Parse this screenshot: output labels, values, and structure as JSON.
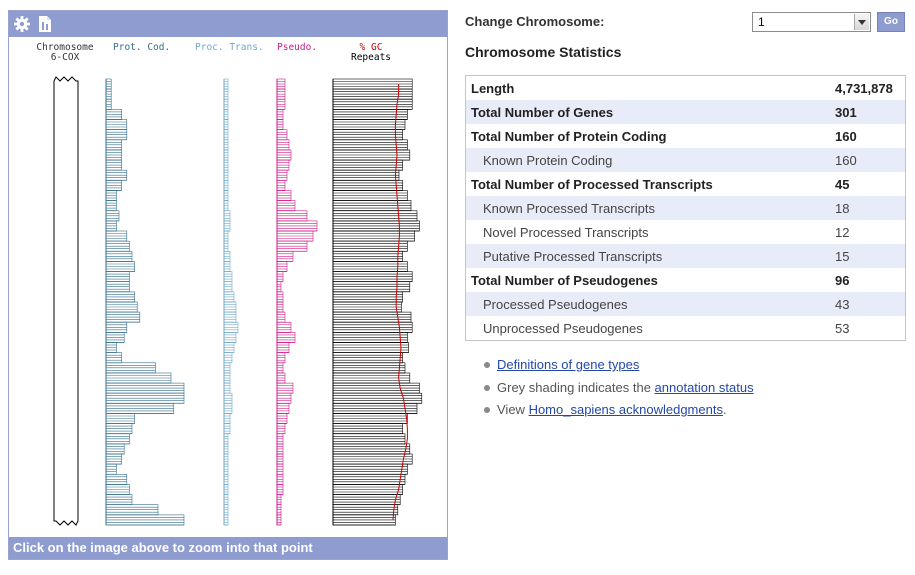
{
  "panel": {
    "footer_text": "Click on the image above to zoom into that point",
    "icons": [
      "gear-icon",
      "karyotype-icon"
    ],
    "tracks": {
      "chromosome_label": "Chromosome",
      "chromosome_name": "6-COX",
      "prot_cod_label": "Prot. Cod.",
      "proc_trans_label": "Proc. Trans.",
      "pseudo_label": "Pseudo.",
      "gc_label": "% GC",
      "repeats_label": "Repeats"
    },
    "colors": {
      "prot_cod": "#336e8c",
      "proc_trans": "#6fa8c8",
      "pseudo": "#cc1a8a",
      "gc": "#cc0000",
      "repeats": "#000000",
      "header": "#8f9cd0"
    }
  },
  "density": {
    "bins": 44,
    "prot_cod": [
      2,
      2,
      2,
      6,
      8,
      8,
      6,
      6,
      6,
      8,
      6,
      4,
      4,
      5,
      4,
      8,
      9,
      10,
      11,
      9,
      9,
      11,
      12,
      13,
      8,
      7,
      4,
      6,
      19,
      25,
      30,
      30,
      26,
      11,
      10,
      9,
      7,
      6,
      4,
      8,
      9,
      10,
      20,
      30
    ],
    "proc_trans": [
      2,
      2,
      2,
      2,
      2,
      2,
      2,
      2,
      2,
      2,
      2,
      2,
      2,
      3,
      3,
      2,
      2,
      3,
      3,
      4,
      4,
      5,
      6,
      6,
      7,
      6,
      5,
      4,
      3,
      3,
      3,
      4,
      4,
      3,
      3,
      2,
      2,
      2,
      2,
      2,
      2,
      2,
      2,
      2
    ],
    "pseudo": [
      4,
      4,
      4,
      3,
      3,
      5,
      6,
      7,
      6,
      5,
      4,
      7,
      9,
      15,
      20,
      18,
      15,
      8,
      5,
      3,
      2,
      3,
      3,
      4,
      7,
      9,
      6,
      4,
      3,
      4,
      8,
      7,
      6,
      5,
      4,
      3,
      3,
      3,
      3,
      3,
      3,
      2,
      2,
      2
    ],
    "repeats": [
      66,
      66,
      66,
      62,
      60,
      58,
      62,
      64,
      58,
      55,
      58,
      62,
      65,
      70,
      72,
      68,
      62,
      58,
      62,
      66,
      64,
      58,
      57,
      65,
      66,
      62,
      63,
      58,
      60,
      64,
      72,
      74,
      70,
      62,
      58,
      60,
      64,
      66,
      62,
      60,
      58,
      56,
      54,
      52
    ],
    "gc": [
      0.82,
      0.82,
      0.8,
      0.79,
      0.78,
      0.78,
      0.79,
      0.8,
      0.79,
      0.78,
      0.79,
      0.8,
      0.81,
      0.82,
      0.83,
      0.83,
      0.82,
      0.81,
      0.81,
      0.8,
      0.8,
      0.79,
      0.79,
      0.81,
      0.83,
      0.84,
      0.85,
      0.84,
      0.83,
      0.82,
      0.84,
      0.88,
      0.9,
      0.92,
      0.93,
      0.93,
      0.91,
      0.88,
      0.86,
      0.84,
      0.82,
      0.78,
      0.76,
      0.75
    ]
  },
  "controls": {
    "change_label": "Change Chromosome:",
    "selected": "1",
    "go_label": "Go"
  },
  "stats": {
    "title": "Chromosome Statistics",
    "rows": [
      {
        "label": "Length",
        "value": "4,731,878",
        "level": "main"
      },
      {
        "label": "Total Number of Genes",
        "value": "301",
        "level": "main"
      },
      {
        "label": "Total Number of Protein Coding",
        "value": "160",
        "level": "main"
      },
      {
        "label": "Known Protein Coding",
        "value": "160",
        "level": "sub"
      },
      {
        "label": "Total Number of Processed Transcripts",
        "value": "45",
        "level": "main"
      },
      {
        "label": "Known Processed Transcripts",
        "value": "18",
        "level": "sub"
      },
      {
        "label": "Novel Processed Transcripts",
        "value": "12",
        "level": "sub"
      },
      {
        "label": "Putative Processed Transcripts",
        "value": "15",
        "level": "sub"
      },
      {
        "label": "Total Number of Pseudogenes",
        "value": "96",
        "level": "main"
      },
      {
        "label": "Processed Pseudogenes",
        "value": "43",
        "level": "sub"
      },
      {
        "label": "Unprocessed Pseudogenes",
        "value": "53",
        "level": "sub"
      }
    ]
  },
  "notes": {
    "n1_link": "Definitions of gene types",
    "n2_pre": "Grey shading indicates the ",
    "n2_link": "annotation status",
    "n3_pre": "View ",
    "n3_link": "Homo_sapiens acknowledgments",
    "n3_post": "."
  }
}
